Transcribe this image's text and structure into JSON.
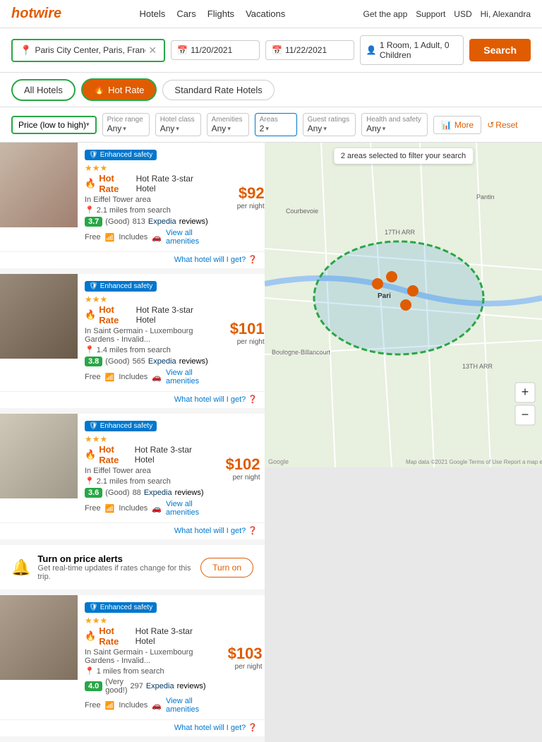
{
  "header": {
    "logo": "hotwire",
    "nav": [
      "Hotels",
      "Cars",
      "Flights",
      "Vacations"
    ],
    "right": [
      "Get the app",
      "Support",
      "USD",
      "Hi, Alexandra"
    ]
  },
  "search": {
    "location": "Paris City Center, Paris, France",
    "checkin": "11/20/2021",
    "checkout": "11/22/2021",
    "guests": "1 Room, 1 Adult, 0 Children",
    "search_btn": "Search"
  },
  "tabs": [
    {
      "label": "All Hotels",
      "active": false
    },
    {
      "label": "Hot Rate",
      "active": true
    },
    {
      "label": "Standard Rate Hotels",
      "active": false
    }
  ],
  "filters": {
    "sort_label": "Price (low to high)",
    "price_range": {
      "label": "Price range",
      "value": "Any"
    },
    "hotel_class": {
      "label": "Hotel class",
      "value": "Any"
    },
    "amenities": {
      "label": "Amenities",
      "value": "Any"
    },
    "areas": {
      "label": "Areas",
      "value": "2"
    },
    "guest_ratings": {
      "label": "Guest ratings",
      "value": "Any"
    },
    "health_safety": {
      "label": "Health and safety",
      "value": "Any"
    },
    "more_btn": "More",
    "reset_btn": "Reset"
  },
  "map": {
    "notice": "2 areas selected to filter your search"
  },
  "hotels": [
    {
      "id": 1,
      "badge": "Enhanced safety",
      "stars": 3,
      "name": "Hot Rate 3-star Hotel",
      "area": "In Eiffel Tower area",
      "distance": "2.1 miles from search",
      "rating": "3.7",
      "rating_label": "Good",
      "reviews": "813",
      "review_source": "Expedia",
      "amenities": [
        "Free",
        "WiFi",
        "Includes",
        "Parking"
      ],
      "view_amenities": "View all amenities",
      "price": "$92",
      "per_night": "per night",
      "what_hotel": "What hotel will I get?",
      "img_color": "#b8a89a"
    },
    {
      "id": 2,
      "badge": "Enhanced safety",
      "stars": 3,
      "name": "Hot Rate 3-star Hotel",
      "area": "In Saint Germain - Luxembourg Gardens - Invalid...",
      "distance": "1.4 miles from search",
      "rating": "3.8",
      "rating_label": "Good",
      "reviews": "565",
      "review_source": "Expedia",
      "amenities": [
        "Free",
        "WiFi",
        "Includes",
        "Parking"
      ],
      "view_amenities": "View all amenities",
      "price": "$101",
      "per_night": "per night",
      "what_hotel": "What hotel will I get?",
      "img_color": "#8a7a6a"
    },
    {
      "id": 3,
      "badge": "Enhanced safety",
      "stars": 3,
      "name": "Hot Rate 3-star Hotel",
      "area": "In Eiffel Tower area",
      "distance": "2.1 miles from search",
      "rating": "3.6",
      "rating_label": "Good",
      "reviews": "88",
      "review_source": "Expedia",
      "amenities": [
        "Free",
        "WiFi",
        "Includes",
        "Parking"
      ],
      "view_amenities": "View all amenities",
      "price": "$102",
      "per_night": "per night",
      "what_hotel": "What hotel will I get?",
      "img_color": "#c0b8a8"
    },
    {
      "id": 4,
      "badge": "Enhanced safety",
      "stars": 3,
      "name": "Hot Rate 3-star Hotel",
      "area": "In Saint Germain - Luxembourg Gardens - Invalid...",
      "distance": "1 miles from search",
      "rating": "4.0",
      "rating_label": "Very good!",
      "reviews": "297",
      "review_source": "Expedia",
      "amenities": [
        "Free",
        "WiFi",
        "Includes",
        "Parking"
      ],
      "view_amenities": "View all amenities",
      "price": "$103",
      "per_night": "per night",
      "what_hotel": "What hotel will I get?",
      "img_color": "#a09080"
    }
  ],
  "price_alert": {
    "title": "Turn on price alerts",
    "desc": "Get real-time updates if rates change for this trip.",
    "btn": "Turn on"
  }
}
